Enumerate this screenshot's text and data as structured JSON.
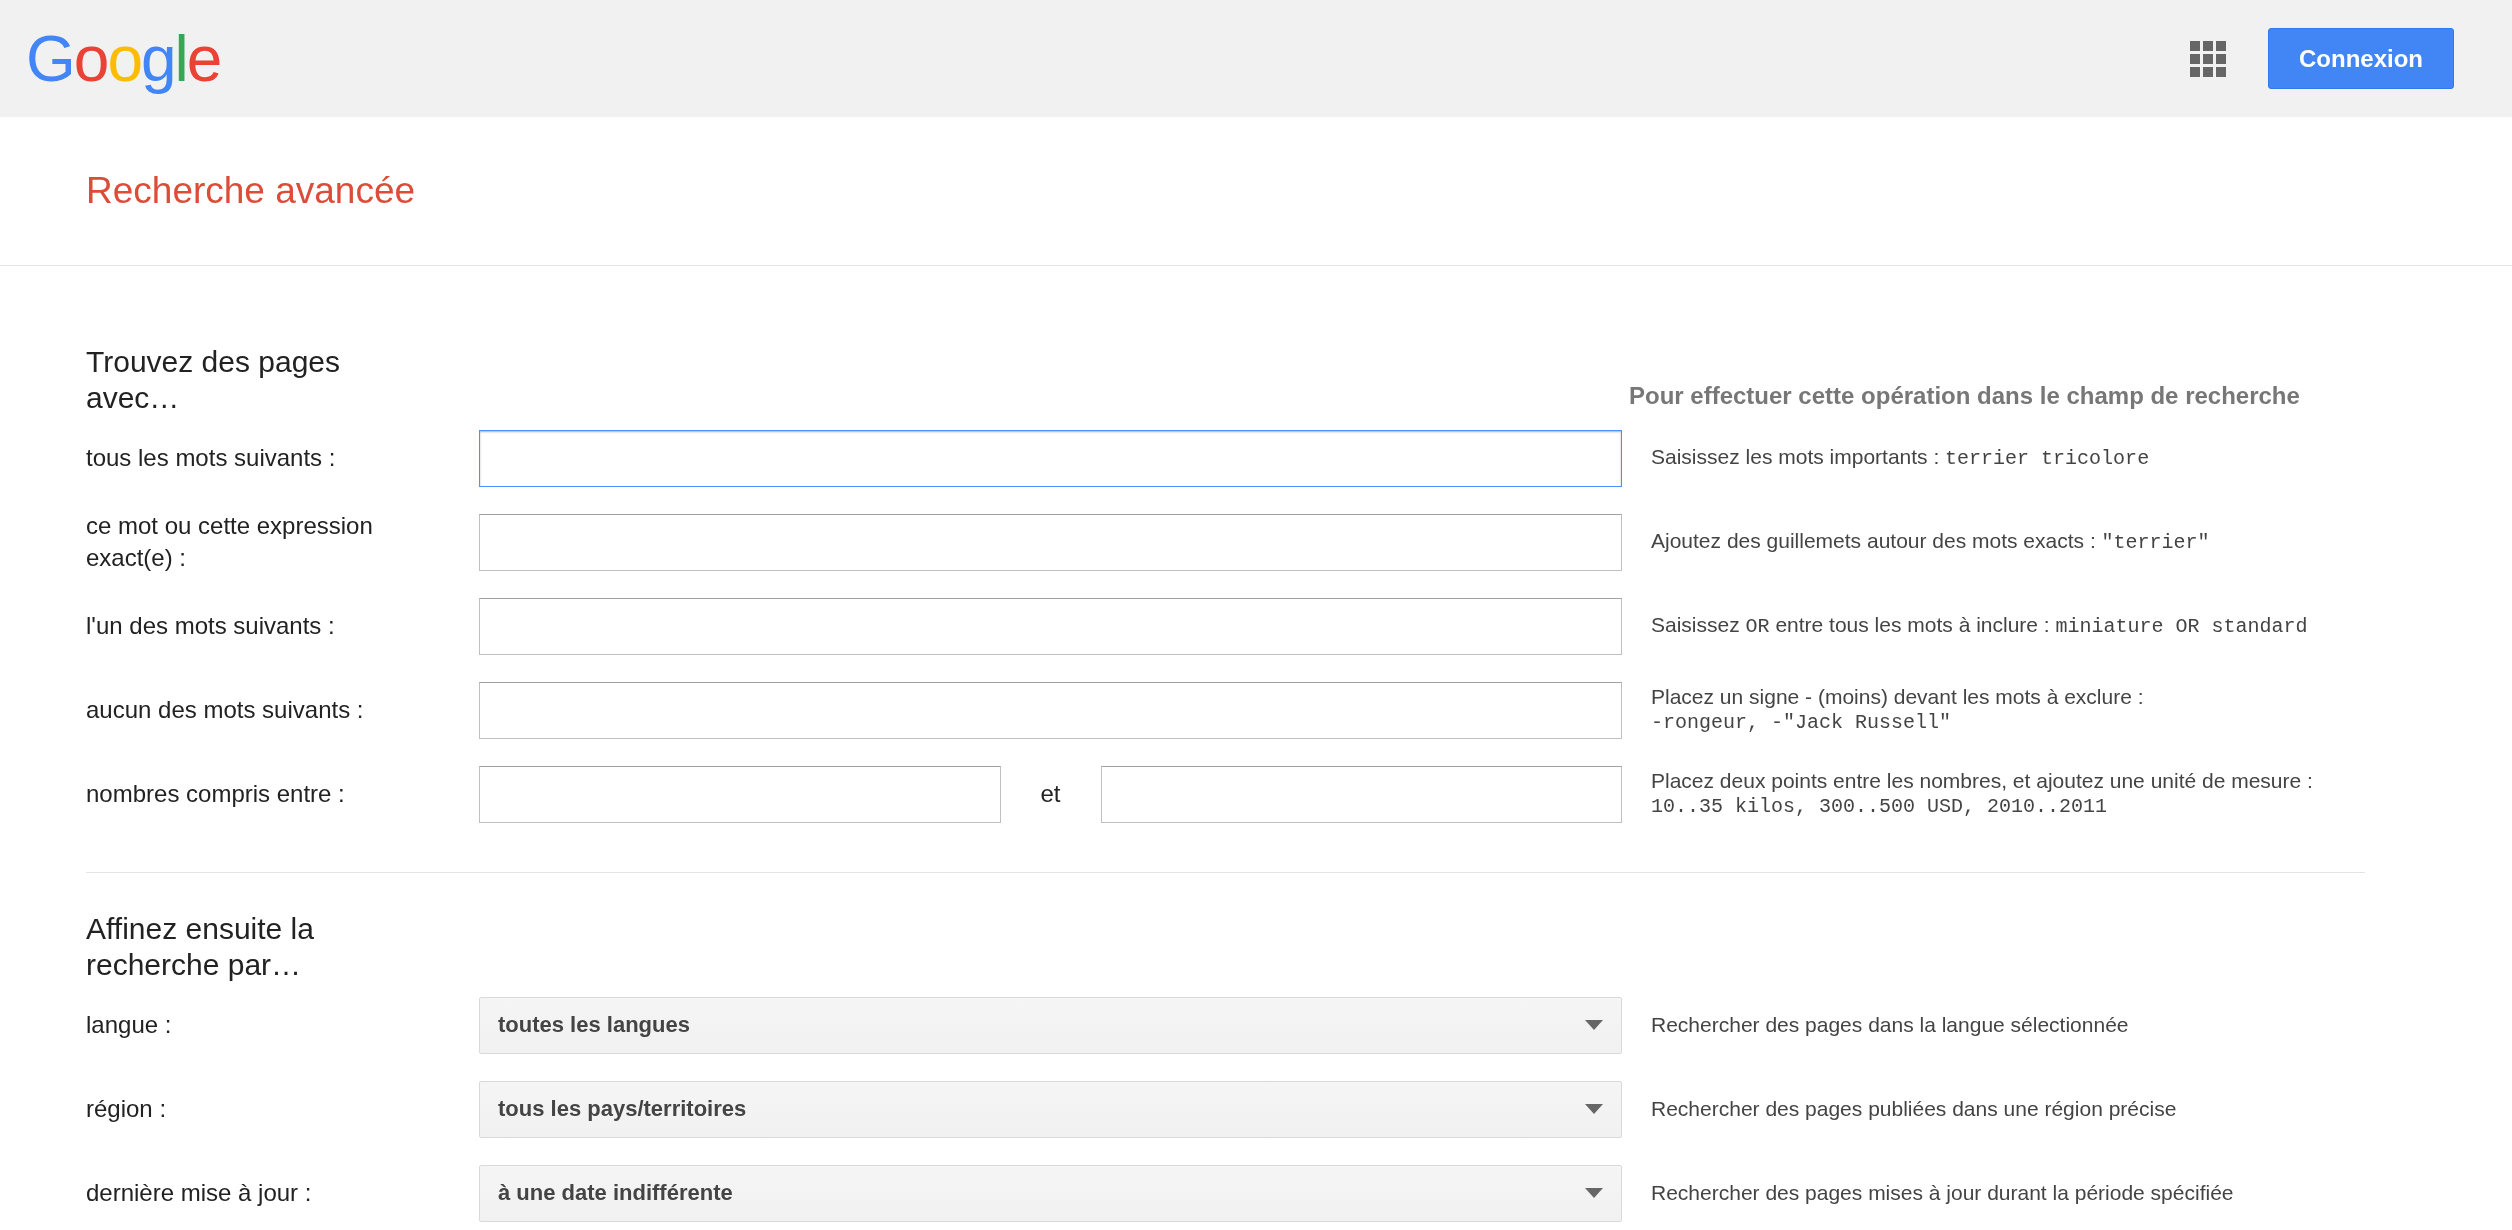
{
  "header": {
    "logo": "Google",
    "signin_button": "Connexion"
  },
  "page_title": "Recherche avancée",
  "find_section": {
    "heading": "Trouvez des pages avec…",
    "hint_heading": "Pour effectuer cette opération dans le champ de recherche",
    "rows": [
      {
        "kind": "text",
        "label": "tous les mots suivants :",
        "focused": true,
        "hint": [
          {
            "kind": "text",
            "text": "Saisissez les mots importants : "
          },
          {
            "kind": "code",
            "text": "terrier tricolore"
          }
        ]
      },
      {
        "kind": "text",
        "label": "ce mot ou cette expression exact(e) :",
        "focused": false,
        "hint": [
          {
            "kind": "text",
            "text": "Ajoutez des guillemets autour des mots exacts : "
          },
          {
            "kind": "code",
            "text": "\"terrier\""
          }
        ]
      },
      {
        "kind": "text",
        "label": "l'un des mots suivants :",
        "focused": false,
        "hint": [
          {
            "kind": "text",
            "text": "Saisissez "
          },
          {
            "kind": "code",
            "text": "OR"
          },
          {
            "kind": "text",
            "text": " entre tous les mots à inclure : "
          },
          {
            "kind": "code",
            "text": "miniature OR standard"
          }
        ]
      },
      {
        "kind": "text",
        "label": "aucun des mots suivants :",
        "focused": false,
        "hint": [
          {
            "kind": "text",
            "text": "Placez un signe - (moins) devant les mots à exclure : "
          },
          {
            "kind": "code-line",
            "text": "-rongeur, -\"Jack Russell\""
          }
        ]
      },
      {
        "kind": "range",
        "label": "nombres compris entre :",
        "focused": false,
        "separator": "et",
        "hint": [
          {
            "kind": "text",
            "text": "Placez deux points entre les nombres, et ajoutez une unité de mesure : "
          },
          {
            "kind": "code-line",
            "text": "10..35 kilos, 300..500 USD, 2010..2011"
          }
        ]
      }
    ]
  },
  "refine_section": {
    "heading": "Affinez ensuite la recherche par…",
    "rows": [
      {
        "label": "langue :",
        "value": "toutes les langues",
        "hint": "Rechercher des pages dans la langue sélectionnée"
      },
      {
        "label": "région :",
        "value": "tous les pays/territoires",
        "hint": "Rechercher des pages publiées dans une région précise"
      },
      {
        "label": "dernière mise à jour :",
        "value": "à une date indifférente",
        "hint": "Rechercher des pages mises à jour durant la période spécifiée"
      }
    ]
  }
}
